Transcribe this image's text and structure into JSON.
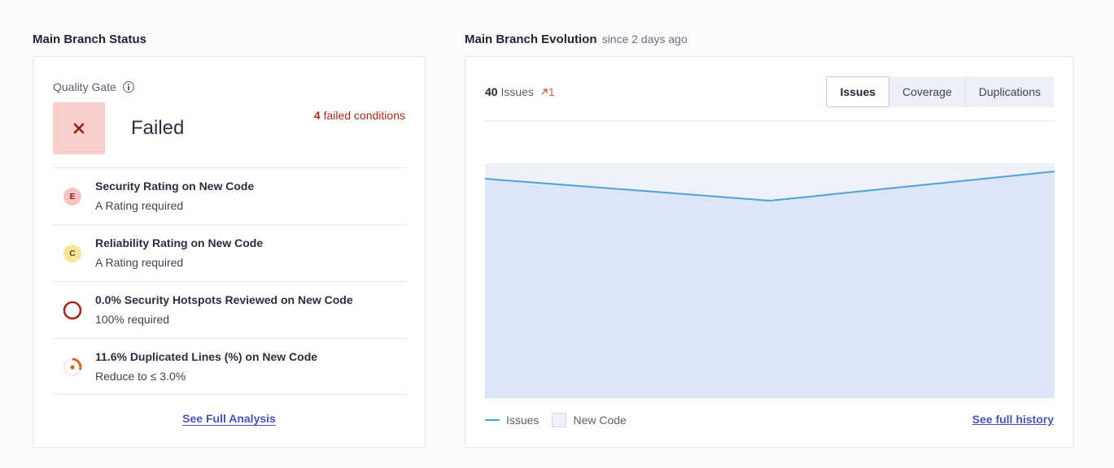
{
  "status": {
    "title": "Main Branch Status",
    "quality_gate_label": "Quality Gate",
    "status_text": "Failed",
    "failed_count": "4",
    "failed_suffix": "failed conditions",
    "conditions": [
      {
        "icon": "rating-e",
        "badge": "E",
        "title": "Security Rating on New Code",
        "subtitle": "A Rating required"
      },
      {
        "icon": "rating-c",
        "badge": "C",
        "title": "Reliability Rating on New Code",
        "subtitle": "A Rating required"
      },
      {
        "icon": "hotspot-ring-icon",
        "title": "0.0% Security Hotspots Reviewed on New Code",
        "subtitle": "100% required"
      },
      {
        "icon": "duplication-donut-icon",
        "title": "11.6% Duplicated Lines (%) on New Code",
        "subtitle": "Reduce to ≤ 3.0%"
      }
    ],
    "full_analysis_link": "See Full Analysis",
    "colors": {
      "failed_bg": "#f9cecb",
      "failed_text": "#a52a1c",
      "link": "#4a54b5"
    }
  },
  "evolution": {
    "title": "Main Branch Evolution",
    "since": "since 2 days ago",
    "issues_count": "40",
    "issues_label": "Issues",
    "trend_value": "1",
    "trend_icon": "arrow-up-right-icon",
    "tabs": [
      {
        "label": "Issues",
        "active": true
      },
      {
        "label": "Coverage",
        "active": false
      },
      {
        "label": "Duplications",
        "active": false
      }
    ],
    "legend_issues": "Issues",
    "legend_new_code": "New Code",
    "history_link": "See full history",
    "colors": {
      "line": "#4fa0d8",
      "area": "#dbe6f6",
      "new_code": "#eff1fa"
    }
  },
  "chart_data": {
    "type": "area",
    "series": [
      {
        "name": "Issues",
        "values": [
          39,
          36,
          40
        ]
      }
    ],
    "new_code_band": true,
    "ylim": [
      0,
      41
    ],
    "grid": false,
    "legend": "bottom-left"
  }
}
